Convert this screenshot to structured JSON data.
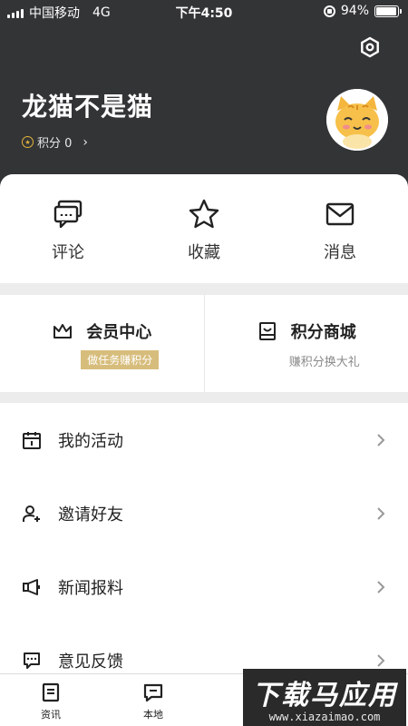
{
  "status_bar": {
    "carrier": "中国移动",
    "network": "4G",
    "time": "下午4:50",
    "battery_text": "94%",
    "battery_level": 0.94
  },
  "profile": {
    "username": "龙猫不是猫",
    "points_label": "积分 0"
  },
  "quick_actions": [
    {
      "label": "评论",
      "icon": "comment-icon"
    },
    {
      "label": "收藏",
      "icon": "star-icon"
    },
    {
      "label": "消息",
      "icon": "mail-icon"
    }
  ],
  "member": {
    "center_title": "会员中心",
    "center_tag": "做任务赚积分",
    "mall_title": "积分商城",
    "mall_sub": "赚积分换大礼"
  },
  "menu": [
    {
      "label": "我的活动",
      "icon": "calendar-icon"
    },
    {
      "label": "邀请好友",
      "icon": "add-user-icon"
    },
    {
      "label": "新闻报料",
      "icon": "megaphone-icon"
    },
    {
      "label": "意见反馈",
      "icon": "feedback-icon"
    }
  ],
  "tabbar": [
    {
      "label": "资讯",
      "icon": "news-icon"
    },
    {
      "label": "本地",
      "icon": "local-icon"
    }
  ],
  "watermark": {
    "title": "下载马应用",
    "url": "www.xiazaimao.com"
  },
  "colors": {
    "header_bg": "#333436",
    "gold": "#d7bd7c",
    "coin": "#e3b53a"
  }
}
